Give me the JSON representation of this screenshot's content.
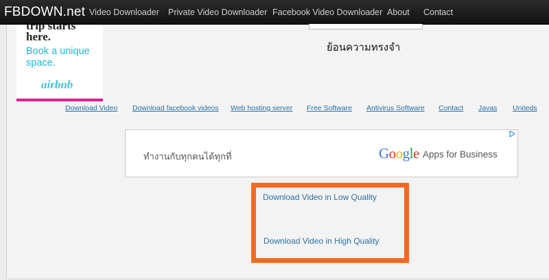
{
  "brand": "FBDOWN.net",
  "nav": [
    {
      "label": "Video Downloader"
    },
    {
      "label": "Private Video Downloader"
    },
    {
      "label": "Facebook Video Downloader"
    },
    {
      "label": "About"
    },
    {
      "label": "Contact"
    }
  ],
  "airbnb_ad": {
    "clipped_line": "trip starts",
    "line1": "here.",
    "tagline": "Book a unique space.",
    "logo": "airbnb",
    "accent_color": "#e81c8e",
    "text_color": "#1fb7cf"
  },
  "thai_title": "ย้อนความทรงจำ",
  "footer_links": [
    {
      "label": "Download Video"
    },
    {
      "label": "Download facebook videos"
    },
    {
      "label": "Web hosting server"
    },
    {
      "label": "Free Software"
    },
    {
      "label": "Antivirus Software"
    },
    {
      "label": "Contact"
    },
    {
      "label": "Javas"
    },
    {
      "label": "Uniteds"
    }
  ],
  "google_ad": {
    "text": "ทำงานกับทุกคนได้ทุกที่",
    "google_word": "Google",
    "product": "Apps for Business",
    "adchoices_icon": "adchoices-triangle-icon"
  },
  "download": {
    "low_quality": "Download Video in Low Quality",
    "high_quality": "Download Video in High Quality",
    "highlight_color": "#f26a21",
    "link_color": "#2a6fa6"
  }
}
